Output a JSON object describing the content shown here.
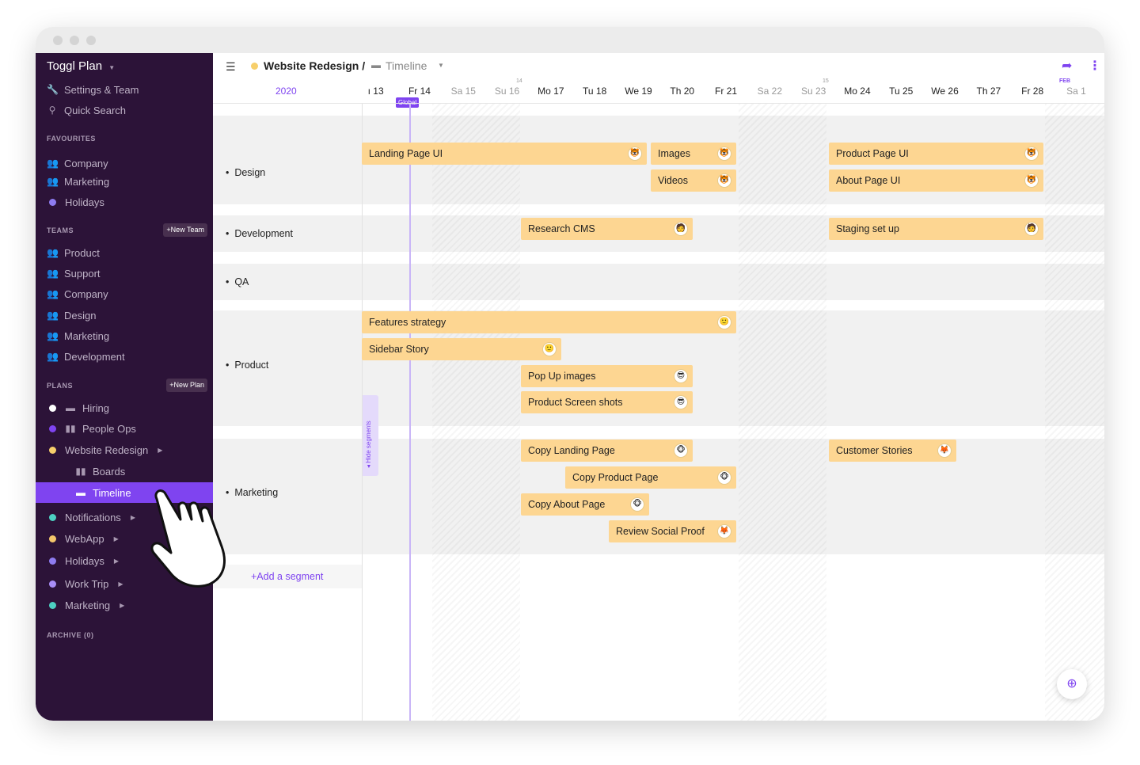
{
  "sidebar": {
    "app_title": "Toggl Plan",
    "settings": "Settings & Team",
    "search": "Quick Search",
    "favourites_head": "FAVOURITES",
    "favourites": [
      "Company",
      "Marketing",
      "Holidays"
    ],
    "teams_head": "TEAMS",
    "new_team": "+New Team",
    "teams": [
      "Product",
      "Support",
      "Company",
      "Design",
      "Marketing",
      "Development"
    ],
    "plans_head": "PLANS",
    "new_plan": "+New Plan",
    "plans": [
      "Hiring",
      "People Ops",
      "Website Redesign"
    ],
    "sub_items": [
      "Boards",
      "Timeline"
    ],
    "more_plans": [
      "Notifications",
      "WebApp",
      "Holidays",
      "Work Trip",
      "Marketing"
    ],
    "archive": "ARCHIVE (0)",
    "colors": {
      "holidays": "#8e7cf0",
      "hiring": "#ffffff",
      "people_ops": "#7f44f0",
      "website": "#f7cf6b",
      "notifications": "#4dd0c2",
      "webapp": "#f3c66b",
      "holidays2": "#8e7cf0",
      "worktrip": "#a98ef7",
      "marketing2": "#4dd0c2"
    }
  },
  "header": {
    "project": "Website Redesign /",
    "view": "Timeline",
    "year": "2020",
    "global_label": "Global"
  },
  "days": [
    "ı 13",
    "Fr 14",
    "Sa 15",
    "Su 16",
    "Mo 17",
    "Tu 18",
    "We 19",
    "Th 20",
    "Fr 21",
    "Sa 22",
    "Su 23",
    "Mo 24",
    "Tu 25",
    "We 26",
    "Th 27",
    "Fr 28",
    "Sa 1"
  ],
  "week_numbers": [
    "14",
    "15"
  ],
  "month_label": "FEB",
  "segments": [
    "Design",
    "Development",
    "QA",
    "Product",
    "Marketing"
  ],
  "add_segment": "+Add a segment",
  "hide_segments": "Hide segments",
  "tasks": {
    "design": [
      "Landing Page UI",
      "Images",
      "Videos",
      "Product Page UI",
      "About Page UI"
    ],
    "development": [
      "Research CMS",
      "Staging set up"
    ],
    "product": [
      "Features strategy",
      "Sidebar Story",
      "Pop Up images",
      "Product Screen shots"
    ],
    "marketing": [
      "Copy Landing Page",
      "Copy Product Page",
      "Copy About Page",
      "Review Social Proof",
      "Customer Stories"
    ]
  },
  "accent": "#7f44f0",
  "task_color": "#fdd692"
}
